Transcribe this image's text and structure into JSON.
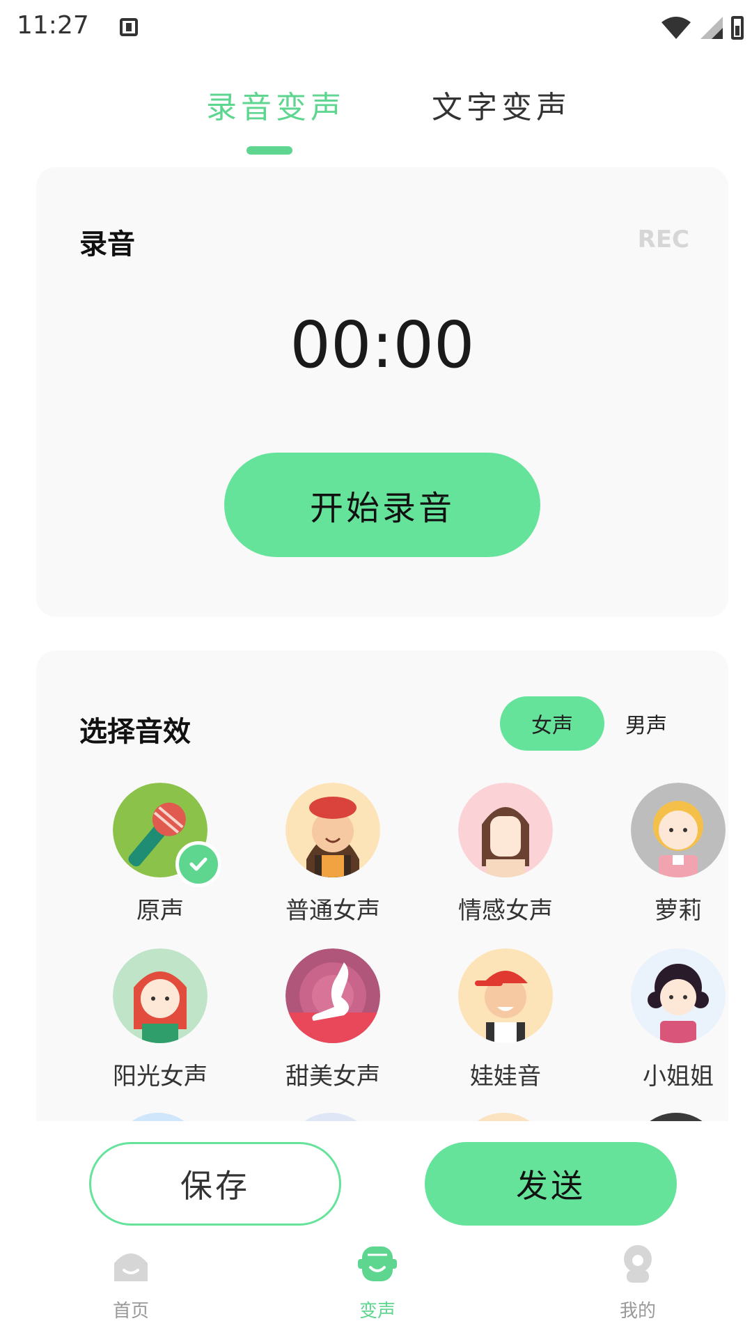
{
  "status_bar": {
    "time": "11:27"
  },
  "top_tabs": [
    {
      "label": "录音变声",
      "active": true
    },
    {
      "label": "文字变声",
      "active": false
    }
  ],
  "record_card": {
    "title": "录音",
    "rec_label": "REC",
    "timer": "00:00",
    "start_button": "开始录音"
  },
  "effects_card": {
    "title": "选择音效",
    "gender_options": {
      "female": "女声",
      "male": "男声",
      "selected": "女声"
    },
    "effects": [
      {
        "label": "原声",
        "icon": "microphone-avatar",
        "selected": true
      },
      {
        "label": "普通女声",
        "icon": "girl-red-beret-avatar",
        "selected": false
      },
      {
        "label": "情感女声",
        "icon": "long-hair-girl-avatar",
        "selected": false
      },
      {
        "label": "萝莉",
        "icon": "blonde-girl-avatar",
        "selected": false
      },
      {
        "label": "阳光女声",
        "icon": "redhead-girl-avatar",
        "selected": false
      },
      {
        "label": "甜美女声",
        "icon": "silhouette-woman-avatar",
        "selected": false
      },
      {
        "label": "娃娃音",
        "icon": "boy-red-cap-avatar",
        "selected": false
      },
      {
        "label": "小姐姐",
        "icon": "dark-hair-girl-avatar",
        "selected": false
      }
    ]
  },
  "actions": {
    "save": "保存",
    "send": "发送"
  },
  "bottom_nav": [
    {
      "label": "首页",
      "icon": "home-icon",
      "active": false
    },
    {
      "label": "变声",
      "icon": "voice-change-icon",
      "active": true
    },
    {
      "label": "我的",
      "icon": "profile-icon",
      "active": false
    }
  ],
  "colors": {
    "accent": "#66e39a",
    "accent_text": "#5ed68f",
    "card_bg": "#f9f9f9"
  }
}
